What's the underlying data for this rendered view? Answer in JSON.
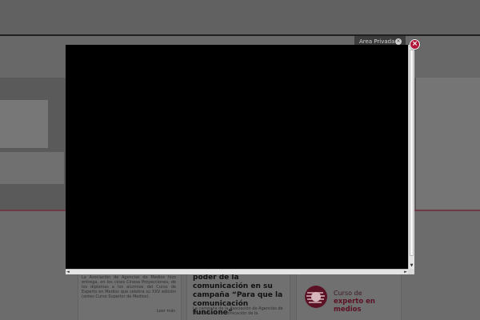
{
  "header": {
    "area_privada_label": "Area Privada"
  },
  "columns": {
    "news_1": {
      "text": "La Asociación de Agencias de Medios hizo entrega, en los cines Cinesa Proyecciones, de los diplomas a los alumnos del Curso de Experto en Medios que celebra su XXV edición (antes Curso Superior de Medios).",
      "read_more": "Leer más"
    },
    "news_2": {
      "title": "poder de la comunicación en su campaña “Para que la comunicación funcione”",
      "text": "La campaña de la Asociación de Agencias de Medios hace comunicación de la"
    },
    "promo": {
      "line1": "Curso de",
      "line2": "experto en medios"
    }
  },
  "modal": {
    "close_glyph": "×",
    "scroll_up": "▲",
    "scroll_down": "▼",
    "scroll_left": "◄",
    "scroll_right": "►"
  },
  "colors": {
    "accent": "#b0163a",
    "overlay": "#5f5f5f",
    "video": "#000000"
  }
}
